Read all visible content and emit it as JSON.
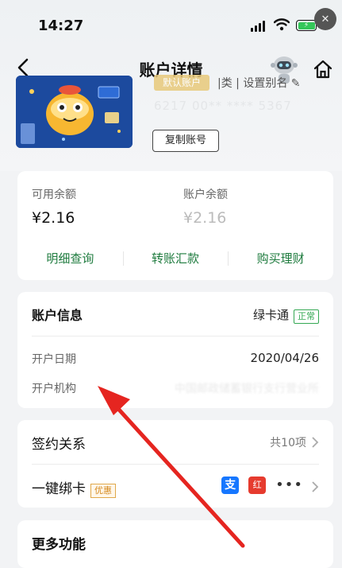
{
  "status": {
    "time": "14:27"
  },
  "nav": {
    "title": "账户详情"
  },
  "card": {
    "default_badge": "默认账户",
    "meta_text": "|类 | 设置别名",
    "account_masked": "6217 00** **** 5367",
    "copy_label": "复制账号"
  },
  "balance": {
    "available_label": "可用余额",
    "available_value": "¥2.16",
    "account_label": "账户余额",
    "account_value": "¥2.16",
    "actions": [
      "明细查询",
      "转账汇款",
      "购买理财"
    ]
  },
  "account_info": {
    "title": "账户信息",
    "card_name": "绿卡通",
    "status": "正常",
    "open_date_label": "开户日期",
    "open_date_value": "2020/04/26",
    "institution_label": "开户机构",
    "institution_value": "中国邮政储蓄银行支行营业所"
  },
  "sign": {
    "title": "签约关系",
    "count": "共10项"
  },
  "bind": {
    "title": "一键绑卡",
    "promo": "优惠",
    "alipay": "支",
    "redpay": "红"
  },
  "more": {
    "title": "更多功能"
  },
  "colors": {
    "accent_green": "#1e7b3e",
    "annotation_red": "#e52520"
  }
}
